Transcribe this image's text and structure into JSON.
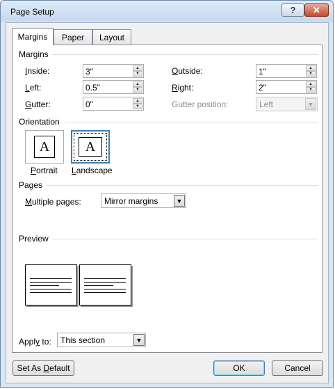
{
  "window": {
    "title": "Page Setup",
    "help_glyph": "?",
    "close_glyph": "✕"
  },
  "tabs": [
    {
      "label": "Margins",
      "active": true
    },
    {
      "label": "Paper",
      "active": false
    },
    {
      "label": "Layout",
      "active": false
    }
  ],
  "margins": {
    "heading": "Margins",
    "inside": {
      "mnemonic": "I",
      "rest": "nside:",
      "value": "3\""
    },
    "outside": {
      "mnemonic": "O",
      "rest": "utside:",
      "value": "1\""
    },
    "left": {
      "mnemonic": "L",
      "rest": "eft:",
      "value": "0.5\""
    },
    "right": {
      "mnemonic": "R",
      "rest": "ight:",
      "value": "2\""
    },
    "gutter": {
      "mnemonic": "G",
      "rest": "utter:",
      "value": "0\""
    },
    "gutter_position": {
      "label": "Gutter position:",
      "value": "Left"
    }
  },
  "orientation": {
    "heading": "Orientation",
    "portrait": {
      "mnemonic": "P",
      "rest": "ortrait",
      "glyph": "A"
    },
    "landscape": {
      "mnemonic": "L",
      "rest": "andscape",
      "glyph": "A",
      "selected": true
    }
  },
  "pages": {
    "heading": "Pages",
    "multiple_pages": {
      "mnemonic": "M",
      "rest": "ultiple pages:",
      "value": "Mirror margins"
    }
  },
  "preview": {
    "heading": "Preview"
  },
  "apply_to": {
    "pre": "Appl",
    "mnemonic": "y",
    "rest": " to:",
    "value": "This section"
  },
  "buttons": {
    "set_default": {
      "pre": "Set As ",
      "mnemonic": "D",
      "rest": "efault"
    },
    "ok": "OK",
    "cancel": "Cancel"
  }
}
